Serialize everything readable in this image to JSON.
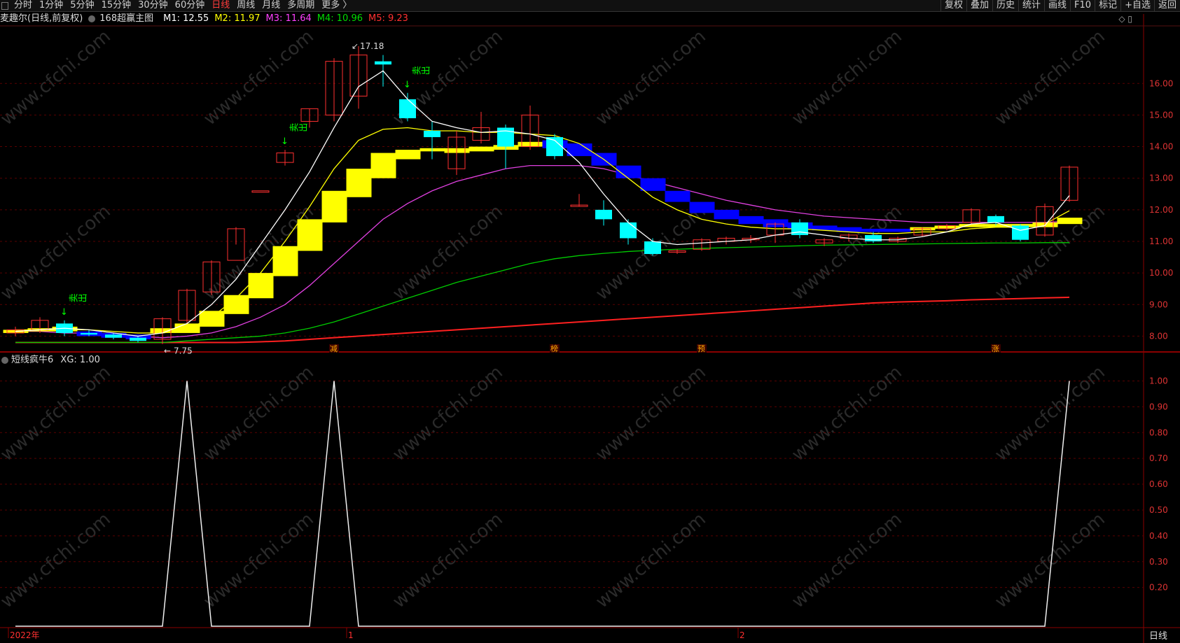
{
  "toolbar": {
    "periods": [
      "分时",
      "1分钟",
      "5分钟",
      "15分钟",
      "30分钟",
      "60分钟",
      "日线",
      "周线",
      "月线",
      "多周期",
      "更多 〉"
    ],
    "active_period": "日线",
    "actions": [
      "复权",
      "叠加",
      "历史",
      "统计",
      "画线",
      "F10",
      "标记",
      "+自选",
      "返回"
    ]
  },
  "info": {
    "stock": "麦趣尔(日线,前复权)",
    "indicator": "168超赢主图",
    "ma": [
      {
        "label": "M1: 12.55",
        "color": "#ffffff"
      },
      {
        "label": "M2: 11.97",
        "color": "#ffff00"
      },
      {
        "label": "M3: 11.64",
        "color": "#ff40ff"
      },
      {
        "label": "M4: 10.96",
        "color": "#00dd00"
      },
      {
        "label": "M5: 9.23",
        "color": "#ff3030"
      }
    ]
  },
  "sub": {
    "title": "短线疯牛6",
    "value": "XG: 1.00"
  },
  "main_axis": [
    "16.00",
    "15.00",
    "14.00",
    "13.00",
    "12.00",
    "11.00",
    "10.00",
    "9.00",
    "8.00"
  ],
  "sub_axis": [
    "1.00",
    "0.90",
    "0.80",
    "0.70",
    "0.60",
    "0.50",
    "0.40",
    "0.30",
    "0.20"
  ],
  "annotations": {
    "high": "17.18",
    "low": "7.75",
    "sell": "卖出",
    "bottom_marks": [
      "减",
      "榜",
      "预",
      "涨"
    ]
  },
  "time_labels": [
    "2022年",
    "1",
    "2"
  ],
  "period_label": "日线",
  "watermark": "www.cfchi.com",
  "chart_data": {
    "type": "candlestick",
    "y_range": [
      7.5,
      17.8
    ],
    "candles": [
      {
        "o": 8.1,
        "c": 8.2,
        "h": 8.3,
        "l": 8.0
      },
      {
        "o": 8.2,
        "c": 8.5,
        "h": 8.6,
        "l": 8.1
      },
      {
        "o": 8.4,
        "c": 8.1,
        "h": 8.5,
        "l": 8.0
      },
      {
        "o": 8.1,
        "c": 8.05,
        "h": 8.2,
        "l": 8.0
      },
      {
        "o": 8.05,
        "c": 7.95,
        "h": 8.1,
        "l": 7.9
      },
      {
        "o": 7.95,
        "c": 7.85,
        "h": 8.0,
        "l": 7.8
      },
      {
        "o": 7.9,
        "c": 8.55,
        "h": 8.6,
        "l": 7.75
      },
      {
        "o": 8.5,
        "c": 9.45,
        "h": 9.5,
        "l": 8.4
      },
      {
        "o": 9.4,
        "c": 10.35,
        "h": 10.4,
        "l": 9.3
      },
      {
        "o": 10.4,
        "c": 11.4,
        "h": 11.45,
        "l": 10.9
      },
      {
        "o": 12.6,
        "c": 12.6,
        "h": 12.6,
        "l": 12.6
      },
      {
        "o": 13.5,
        "c": 13.8,
        "h": 13.9,
        "l": 13.4
      },
      {
        "o": 14.8,
        "c": 15.2,
        "h": 15.2,
        "l": 14.6
      },
      {
        "o": 15.0,
        "c": 16.7,
        "h": 16.8,
        "l": 14.8
      },
      {
        "o": 15.6,
        "c": 16.9,
        "h": 17.18,
        "l": 15.2
      },
      {
        "o": 16.7,
        "c": 16.6,
        "h": 16.9,
        "l": 15.9
      },
      {
        "o": 15.5,
        "c": 14.9,
        "h": 15.7,
        "l": 14.8
      },
      {
        "o": 14.5,
        "c": 14.3,
        "h": 14.8,
        "l": 13.6
      },
      {
        "o": 13.3,
        "c": 14.3,
        "h": 14.5,
        "l": 13.1
      },
      {
        "o": 14.2,
        "c": 14.6,
        "h": 15.1,
        "l": 14.1
      },
      {
        "o": 14.6,
        "c": 14.0,
        "h": 14.7,
        "l": 13.3
      },
      {
        "o": 14.0,
        "c": 15.0,
        "h": 15.3,
        "l": 13.9
      },
      {
        "o": 14.3,
        "c": 13.7,
        "h": 14.4,
        "l": 13.6
      },
      {
        "o": 12.15,
        "c": 12.15,
        "h": 12.5,
        "l": 12.1
      },
      {
        "o": 12.0,
        "c": 11.7,
        "h": 12.3,
        "l": 11.5
      },
      {
        "o": 11.6,
        "c": 11.1,
        "h": 11.7,
        "l": 10.9
      },
      {
        "o": 11.0,
        "c": 10.6,
        "h": 11.1,
        "l": 10.55
      },
      {
        "o": 10.7,
        "c": 10.7,
        "h": 10.75,
        "l": 10.6
      },
      {
        "o": 10.75,
        "c": 11.05,
        "h": 11.1,
        "l": 10.7
      },
      {
        "o": 11.0,
        "c": 11.1,
        "h": 11.15,
        "l": 10.9
      },
      {
        "o": 11.05,
        "c": 11.1,
        "h": 11.2,
        "l": 10.95
      },
      {
        "o": 11.2,
        "c": 11.55,
        "h": 11.6,
        "l": 10.95
      },
      {
        "o": 11.6,
        "c": 11.2,
        "h": 11.7,
        "l": 11.1
      },
      {
        "o": 10.95,
        "c": 11.05,
        "h": 11.1,
        "l": 10.85
      },
      {
        "o": 11.1,
        "c": 11.2,
        "h": 11.25,
        "l": 11.0
      },
      {
        "o": 11.2,
        "c": 11.0,
        "h": 11.3,
        "l": 10.95
      },
      {
        "o": 11.0,
        "c": 11.1,
        "h": 11.15,
        "l": 10.95
      },
      {
        "o": 11.2,
        "c": 11.4,
        "h": 11.45,
        "l": 11.15
      },
      {
        "o": 11.4,
        "c": 11.5,
        "h": 11.55,
        "l": 11.35
      },
      {
        "o": 11.6,
        "c": 12.0,
        "h": 12.05,
        "l": 11.55
      },
      {
        "o": 11.8,
        "c": 11.6,
        "h": 11.85,
        "l": 11.5
      },
      {
        "o": 11.5,
        "c": 11.05,
        "h": 11.55,
        "l": 11.0
      },
      {
        "o": 11.2,
        "c": 12.1,
        "h": 12.2,
        "l": 11.15
      },
      {
        "o": 12.3,
        "c": 13.35,
        "h": 13.4,
        "l": 12.25
      }
    ],
    "ribbon": [
      {
        "lo": 8.1,
        "hi": 8.2,
        "c": "#ffff00"
      },
      {
        "lo": 8.15,
        "hi": 8.25,
        "c": "#ffff00"
      },
      {
        "lo": 8.15,
        "hi": 8.3,
        "c": "#ffff00"
      },
      {
        "lo": 8.0,
        "hi": 8.15,
        "c": "#0000ff"
      },
      {
        "lo": 7.95,
        "hi": 8.1,
        "c": "#0000ff"
      },
      {
        "lo": 7.9,
        "hi": 8.05,
        "c": "#0000ff"
      },
      {
        "lo": 8.1,
        "hi": 8.25,
        "c": "#ffff00"
      },
      {
        "lo": 8.1,
        "hi": 8.4,
        "c": "#ffff00"
      },
      {
        "lo": 8.3,
        "hi": 8.8,
        "c": "#ffff00"
      },
      {
        "lo": 8.7,
        "hi": 9.3,
        "c": "#ffff00"
      },
      {
        "lo": 9.2,
        "hi": 10.0,
        "c": "#ffff00"
      },
      {
        "lo": 9.9,
        "hi": 10.85,
        "c": "#ffff00"
      },
      {
        "lo": 10.7,
        "hi": 11.7,
        "c": "#ffff00"
      },
      {
        "lo": 11.6,
        "hi": 12.6,
        "c": "#ffff00"
      },
      {
        "lo": 12.4,
        "hi": 13.3,
        "c": "#ffff00"
      },
      {
        "lo": 13.0,
        "hi": 13.8,
        "c": "#ffff00"
      },
      {
        "lo": 13.6,
        "hi": 13.9,
        "c": "#ffff00"
      },
      {
        "lo": 13.85,
        "hi": 13.95,
        "c": "#ffff00"
      },
      {
        "lo": 13.8,
        "hi": 13.95,
        "c": "#ffff00"
      },
      {
        "lo": 13.85,
        "hi": 14.0,
        "c": "#ffff00"
      },
      {
        "lo": 13.9,
        "hi": 14.05,
        "c": "#ffff00"
      },
      {
        "lo": 14.0,
        "hi": 14.15,
        "c": "#ffff00"
      },
      {
        "lo": 13.95,
        "hi": 14.2,
        "c": "#0000ff"
      },
      {
        "lo": 13.7,
        "hi": 14.1,
        "c": "#0000ff"
      },
      {
        "lo": 13.4,
        "hi": 13.8,
        "c": "#0000ff"
      },
      {
        "lo": 13.0,
        "hi": 13.4,
        "c": "#0000ff"
      },
      {
        "lo": 12.6,
        "hi": 13.0,
        "c": "#0000ff"
      },
      {
        "lo": 12.25,
        "hi": 12.6,
        "c": "#0000ff"
      },
      {
        "lo": 11.9,
        "hi": 12.25,
        "c": "#0000ff"
      },
      {
        "lo": 11.7,
        "hi": 12.0,
        "c": "#0000ff"
      },
      {
        "lo": 11.55,
        "hi": 11.8,
        "c": "#0000ff"
      },
      {
        "lo": 11.45,
        "hi": 11.7,
        "c": "#0000ff"
      },
      {
        "lo": 11.4,
        "hi": 11.6,
        "c": "#0000ff"
      },
      {
        "lo": 11.35,
        "hi": 11.5,
        "c": "#0000ff"
      },
      {
        "lo": 11.3,
        "hi": 11.45,
        "c": "#0000ff"
      },
      {
        "lo": 11.3,
        "hi": 11.4,
        "c": "#0000ff"
      },
      {
        "lo": 11.3,
        "hi": 11.4,
        "c": "#0000ff"
      },
      {
        "lo": 11.35,
        "hi": 11.45,
        "c": "#ffff00"
      },
      {
        "lo": 11.4,
        "hi": 11.5,
        "c": "#ffff00"
      },
      {
        "lo": 11.45,
        "hi": 11.55,
        "c": "#ffff00"
      },
      {
        "lo": 11.45,
        "hi": 11.55,
        "c": "#ffff00"
      },
      {
        "lo": 11.45,
        "hi": 11.55,
        "c": "#ffff00"
      },
      {
        "lo": 11.45,
        "hi": 11.6,
        "c": "#ffff00"
      },
      {
        "lo": 11.55,
        "hi": 11.75,
        "c": "#ffff00"
      }
    ],
    "ma_lines": {
      "M1": [
        8.15,
        8.2,
        8.25,
        8.2,
        8.1,
        8.0,
        8.1,
        8.4,
        9.0,
        9.8,
        10.9,
        12.0,
        13.2,
        14.6,
        15.9,
        16.4,
        15.5,
        14.8,
        14.6,
        14.45,
        14.5,
        14.4,
        14.2,
        13.5,
        12.5,
        11.6,
        11.0,
        10.9,
        10.95,
        11.0,
        11.05,
        11.2,
        11.3,
        11.2,
        11.1,
        11.05,
        11.05,
        11.15,
        11.3,
        11.55,
        11.6,
        11.35,
        11.5,
        12.45
      ],
      "M2": [
        8.2,
        8.2,
        8.2,
        8.2,
        8.15,
        8.1,
        8.1,
        8.2,
        8.6,
        9.2,
        10.0,
        11.0,
        12.1,
        13.3,
        14.2,
        14.55,
        14.6,
        14.5,
        14.5,
        14.45,
        14.45,
        14.4,
        14.35,
        14.1,
        13.6,
        13.0,
        12.4,
        12.0,
        11.7,
        11.55,
        11.45,
        11.4,
        11.4,
        11.35,
        11.3,
        11.25,
        11.25,
        11.3,
        11.3,
        11.4,
        11.45,
        11.45,
        11.55,
        11.97
      ],
      "M3": [
        8.15,
        8.15,
        8.1,
        8.1,
        8.05,
        8.0,
        7.95,
        8.0,
        8.1,
        8.3,
        8.6,
        9.0,
        9.6,
        10.3,
        11.0,
        11.7,
        12.2,
        12.6,
        12.9,
        13.1,
        13.3,
        13.4,
        13.4,
        13.4,
        13.3,
        13.1,
        12.9,
        12.7,
        12.5,
        12.3,
        12.15,
        12.0,
        11.9,
        11.8,
        11.75,
        11.7,
        11.65,
        11.6,
        11.6,
        11.6,
        11.6,
        11.6,
        11.6,
        11.64
      ],
      "M4": [
        7.8,
        7.8,
        7.8,
        7.8,
        7.8,
        7.8,
        7.8,
        7.85,
        7.9,
        7.95,
        8.0,
        8.1,
        8.25,
        8.45,
        8.7,
        8.95,
        9.2,
        9.45,
        9.7,
        9.9,
        10.1,
        10.3,
        10.45,
        10.55,
        10.62,
        10.68,
        10.72,
        10.75,
        10.78,
        10.8,
        10.82,
        10.84,
        10.86,
        10.88,
        10.89,
        10.9,
        10.91,
        10.92,
        10.93,
        10.94,
        10.95,
        10.95,
        10.96,
        10.96
      ],
      "M5": [
        7.8,
        7.8,
        7.8,
        7.8,
        7.8,
        7.8,
        7.8,
        7.8,
        7.8,
        7.8,
        7.82,
        7.85,
        7.9,
        7.95,
        8.0,
        8.05,
        8.1,
        8.15,
        8.2,
        8.25,
        8.3,
        8.35,
        8.4,
        8.45,
        8.5,
        8.55,
        8.6,
        8.65,
        8.7,
        8.75,
        8.8,
        8.85,
        8.9,
        8.95,
        9.0,
        9.05,
        9.08,
        9.1,
        9.12,
        9.15,
        9.17,
        9.19,
        9.21,
        9.23
      ]
    },
    "xg": [
      0,
      0,
      0,
      0,
      0,
      0,
      0,
      1,
      0,
      0,
      0,
      0,
      0,
      1,
      0,
      0,
      0,
      0,
      0,
      0,
      0,
      0,
      0,
      0,
      0,
      0,
      0,
      0,
      0,
      0,
      0,
      0,
      0,
      0,
      0,
      0,
      0,
      0,
      0,
      0,
      0,
      0,
      0,
      1
    ],
    "sell_at": [
      2,
      11,
      16
    ]
  }
}
